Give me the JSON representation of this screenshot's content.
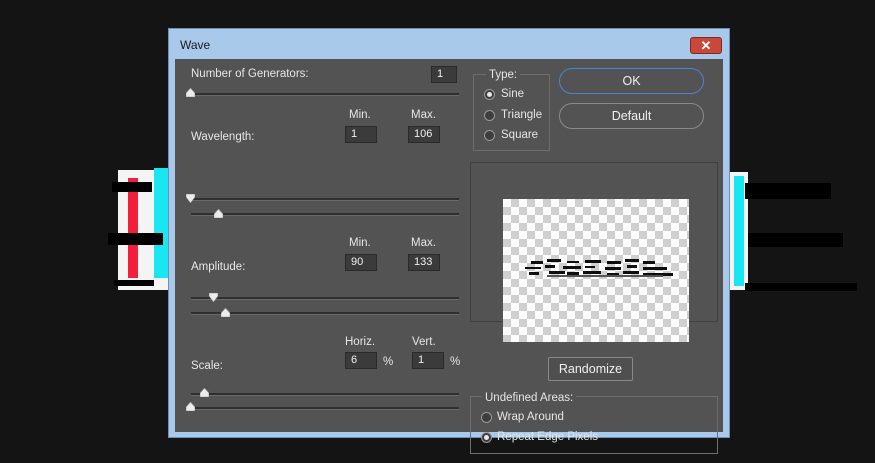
{
  "window": {
    "title": "Wave",
    "close_glyph": "✕"
  },
  "generators": {
    "label": "Number of Generators:",
    "value": "1"
  },
  "columns": {
    "min": "Min.",
    "max": "Max.",
    "horiz": "Horiz.",
    "vert": "Vert."
  },
  "wavelength": {
    "label": "Wavelength:",
    "min": "1",
    "max": "106"
  },
  "amplitude": {
    "label": "Amplitude:",
    "min": "90",
    "max": "133"
  },
  "scale": {
    "label": "Scale:",
    "horiz": "6",
    "vert": "1",
    "unit": "%"
  },
  "type": {
    "label": "Type:",
    "options": [
      "Sine",
      "Triangle",
      "Square"
    ],
    "selected": "Sine"
  },
  "buttons": {
    "ok": "OK",
    "default": "Default",
    "randomize": "Randomize"
  },
  "undefined_areas": {
    "label": "Undefined Areas:",
    "options": [
      "Wrap Around",
      "Repeat Edge Pixels"
    ],
    "selected": "Repeat Edge Pixels"
  },
  "colors": {
    "dialog_bg": "#535353",
    "accent_blue": "#4b83d6",
    "close_red": "#c8493c",
    "title_bar": "#a9c9ea"
  }
}
